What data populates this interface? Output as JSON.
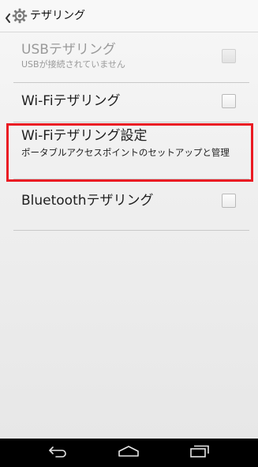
{
  "action_bar": {
    "title": "テザリング",
    "back_icon": "chevron-left-icon",
    "app_icon": "gear-icon"
  },
  "list": {
    "items": [
      {
        "title": "USBテザリング",
        "summary": "USBが接続されていません",
        "checked": false,
        "enabled": false
      },
      {
        "title": "Wi-Fiテザリング",
        "checked": false,
        "enabled": true
      },
      {
        "title": "Wi-Fiテザリング設定",
        "summary": "ポータブルアクセスポイントのセットアップと管理",
        "highlighted": true,
        "highlight_color": "#ea1b23"
      },
      {
        "title": "Bluetoothテザリング",
        "checked": false,
        "enabled": true
      }
    ]
  },
  "nav_bar": {
    "back_icon": "back-icon",
    "home_icon": "home-icon",
    "recents_icon": "recents-icon"
  }
}
